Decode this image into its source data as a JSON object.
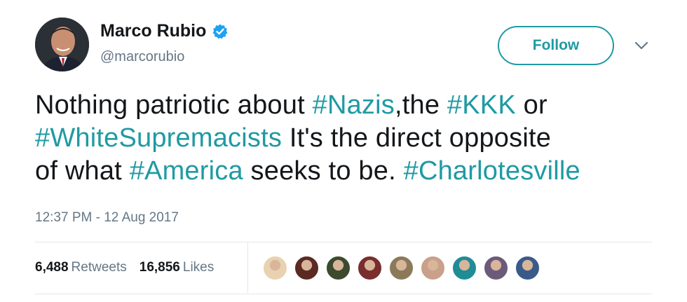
{
  "author": {
    "name": "Marco Rubio",
    "handle": "@marcorubio",
    "verified_icon": "verified-badge-icon"
  },
  "actions": {
    "follow_label": "Follow",
    "menu_icon": "chevron-down-icon"
  },
  "tweet": {
    "lines": [
      [
        {
          "text": "Nothing patriotic about ",
          "tag": false
        },
        {
          "text": "#Nazis",
          "tag": true
        },
        {
          "text": ",the ",
          "tag": false
        },
        {
          "text": "#KKK",
          "tag": true
        },
        {
          "text": " or",
          "tag": false
        }
      ],
      [
        {
          "text": "#WhiteSupremacists",
          "tag": true
        },
        {
          "text": " It's the direct opposite",
          "tag": false
        }
      ],
      [
        {
          "text": "of what ",
          "tag": false
        },
        {
          "text": "#America",
          "tag": true
        },
        {
          "text": " seeks to be. ",
          "tag": false
        },
        {
          "text": "#Charlotesville",
          "tag": true
        }
      ]
    ],
    "timestamp": "12:37 PM - 12 Aug 2017"
  },
  "stats": {
    "retweets_count": "6,488",
    "retweets_label": "Retweets",
    "likes_count": "16,856",
    "likes_label": "Likes"
  },
  "likers": [
    {
      "color": "#e8d2b0"
    },
    {
      "color": "#5b2a22"
    },
    {
      "color": "#3c4a2e"
    },
    {
      "color": "#7a2d2d"
    },
    {
      "color": "#8a7a5a"
    },
    {
      "color": "#c9a08a"
    },
    {
      "color": "#1f8c96"
    },
    {
      "color": "#6b5a7a"
    },
    {
      "color": "#3a5a8a"
    }
  ],
  "colors": {
    "accent": "#1f9aa3",
    "muted": "#657786",
    "verified": "#1da1f2"
  }
}
